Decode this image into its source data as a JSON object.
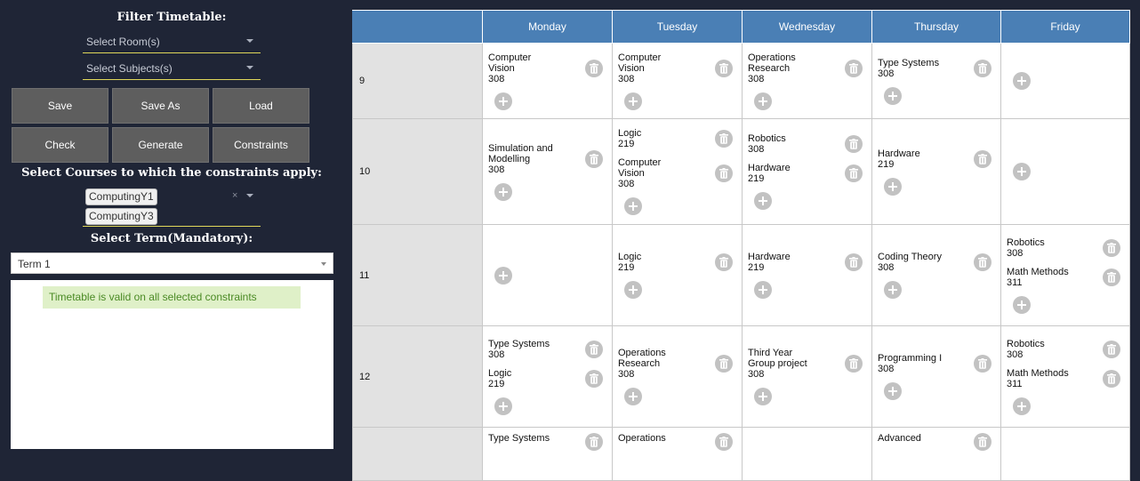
{
  "sidebar": {
    "filter_title": "Filter Timetable:",
    "room_select": "Select Room(s)",
    "subject_select": "Select Subjects(s)",
    "buttons": [
      "Save",
      "Save As",
      "Load",
      "Check",
      "Generate",
      "Constraints"
    ],
    "courses_title": "Select Courses to which the constraints apply:",
    "courses": [
      "ComputingY1",
      "ComputingY3"
    ],
    "clear_glyph": "×",
    "term_title": "Select Term(Mandatory):",
    "term_value": "Term 1",
    "status_message": "Timetable is valid on all selected constraints"
  },
  "timetable": {
    "days": [
      "Monday",
      "Tuesday",
      "Wednesday",
      "Thursday",
      "Friday"
    ],
    "rows": [
      {
        "hour": "9",
        "cells": [
          [
            {
              "name": "Computer\nVision",
              "room": "308"
            }
          ],
          [
            {
              "name": "Computer\nVision",
              "room": "308"
            }
          ],
          [
            {
              "name": "Operations\nResearch",
              "room": "308"
            }
          ],
          [
            {
              "name": "Type Systems",
              "room": "308"
            }
          ],
          []
        ]
      },
      {
        "hour": "10",
        "cells": [
          [
            {
              "name": "Simulation and\nModelling",
              "room": "308"
            }
          ],
          [
            {
              "name": "Logic",
              "room": "219"
            },
            {
              "name": "Computer\nVision",
              "room": "308"
            }
          ],
          [
            {
              "name": "Robotics",
              "room": "308"
            },
            {
              "name": "Hardware",
              "room": "219"
            }
          ],
          [
            {
              "name": "Hardware",
              "room": "219"
            }
          ],
          []
        ]
      },
      {
        "hour": "11",
        "cells": [
          [],
          [
            {
              "name": "Logic",
              "room": "219"
            }
          ],
          [
            {
              "name": "Hardware",
              "room": "219"
            }
          ],
          [
            {
              "name": "Coding Theory",
              "room": "308"
            }
          ],
          [
            {
              "name": "Robotics",
              "room": "308"
            },
            {
              "name": "Math Methods",
              "room": "311"
            }
          ]
        ]
      },
      {
        "hour": "12",
        "cells": [
          [
            {
              "name": "Type Systems",
              "room": "308"
            },
            {
              "name": "Logic",
              "room": "219"
            }
          ],
          [
            {
              "name": "Operations\nResearch",
              "room": "308"
            }
          ],
          [
            {
              "name": "Third Year\nGroup project",
              "room": "308"
            }
          ],
          [
            {
              "name": "Programming I",
              "room": "308"
            }
          ],
          [
            {
              "name": "Robotics",
              "room": "308"
            },
            {
              "name": "Math Methods",
              "room": "311"
            }
          ]
        ]
      },
      {
        "hour": "",
        "cells": [
          [
            {
              "name": "Type Systems",
              "room": ""
            }
          ],
          [
            {
              "name": "Operations",
              "room": ""
            }
          ],
          [],
          [
            {
              "name": "Advanced",
              "room": ""
            }
          ],
          []
        ]
      }
    ]
  }
}
